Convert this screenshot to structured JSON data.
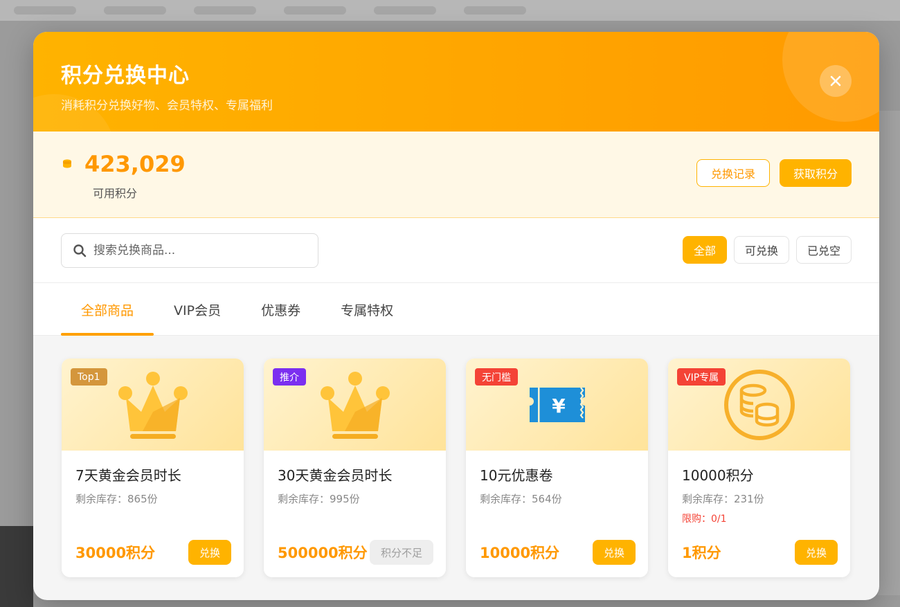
{
  "modal": {
    "title": "积分兑换中心",
    "subtitle": "消耗积分兑换好物、会员特权、专属福利",
    "close_icon": "close-icon"
  },
  "points": {
    "value": "423,029",
    "label": "可用积分",
    "history_button": "兑换记录",
    "earn_button": "获取积分"
  },
  "search": {
    "placeholder": "搜索兑换商品..."
  },
  "filters": [
    {
      "label": "全部",
      "active": true
    },
    {
      "label": "可兑换",
      "active": false
    },
    {
      "label": "已兑空",
      "active": false
    }
  ],
  "tabs": [
    {
      "label": "全部商品",
      "active": true
    },
    {
      "label": "VIP会员",
      "active": false
    },
    {
      "label": "优惠券",
      "active": false
    },
    {
      "label": "专属特权",
      "active": false
    }
  ],
  "products": [
    {
      "badge": "Top1",
      "badge_color": "#d4963c",
      "icon": "crown-icon",
      "name": "7天黄金会员时长",
      "stock": "剩余库存：865份",
      "limit": "",
      "price": "30000积分",
      "button": "兑换",
      "button_disabled": false
    },
    {
      "badge": "推介",
      "badge_color": "#7b2ff0",
      "icon": "crown-icon",
      "name": "30天黄金会员时长",
      "stock": "剩余库存：995份",
      "limit": "",
      "price": "500000积分",
      "button": "积分不足",
      "button_disabled": true
    },
    {
      "badge": "无门槛",
      "badge_color": "#f44336",
      "icon": "coupon-icon",
      "name": "10元优惠卷",
      "stock": "剩余库存：564份",
      "limit": "",
      "price": "10000积分",
      "button": "兑换",
      "button_disabled": false
    },
    {
      "badge": "VIP专属",
      "badge_color": "#f44336",
      "icon": "coins-icon",
      "name": "10000积分",
      "stock": "剩余库存：231份",
      "limit": "限购：0/1",
      "price": "1积分",
      "button": "兑换",
      "button_disabled": false
    }
  ],
  "colors": {
    "accent": "#ffb300",
    "accent_text": "#ff9800",
    "danger": "#f44336"
  }
}
